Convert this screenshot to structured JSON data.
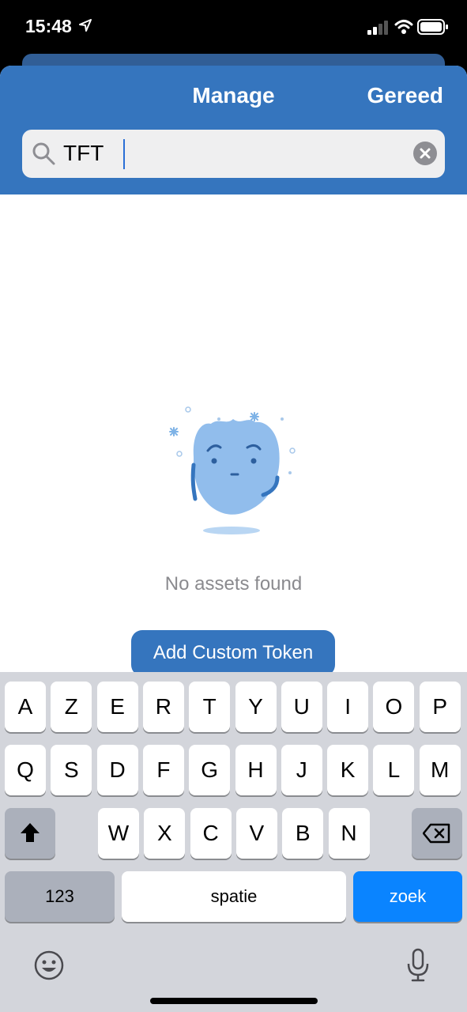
{
  "status_bar": {
    "time": "15:48"
  },
  "header": {
    "title": "Manage",
    "done_label": "Gereed"
  },
  "search": {
    "value": "TFT",
    "placeholder": ""
  },
  "empty_state": {
    "message": "No assets found",
    "button_label": "Add Custom Token"
  },
  "keyboard": {
    "row1": [
      "A",
      "Z",
      "E",
      "R",
      "T",
      "Y",
      "U",
      "I",
      "O",
      "P"
    ],
    "row2": [
      "Q",
      "S",
      "D",
      "F",
      "G",
      "H",
      "J",
      "K",
      "L",
      "M"
    ],
    "row3": [
      "W",
      "X",
      "C",
      "V",
      "B",
      "N"
    ],
    "numbers_label": "123",
    "space_label": "spatie",
    "search_label": "zoek"
  },
  "colors": {
    "accent": "#3575be",
    "key_blue": "#0a84ff"
  }
}
